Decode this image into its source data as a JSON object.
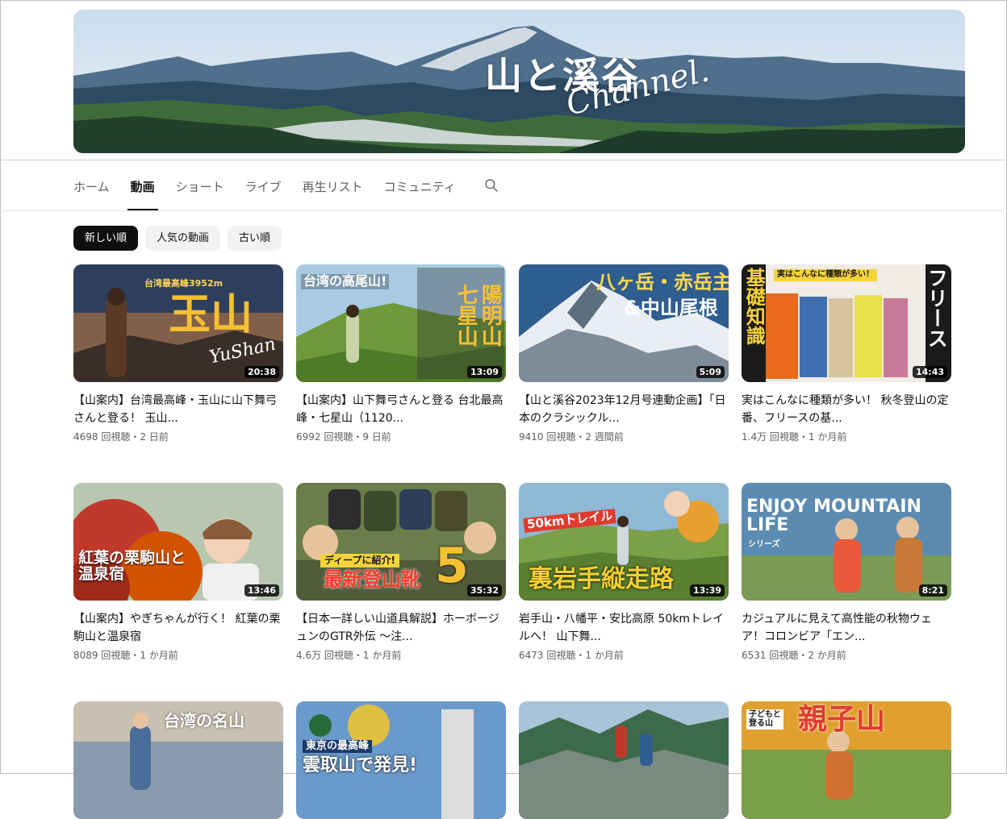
{
  "banner": {
    "title": "山と溪谷",
    "subtitle": "Channel."
  },
  "tabs": [
    {
      "label": "ホーム"
    },
    {
      "label": "動画",
      "active": true
    },
    {
      "label": "ショート"
    },
    {
      "label": "ライブ"
    },
    {
      "label": "再生リスト"
    },
    {
      "label": "コミュニティ"
    }
  ],
  "search": {
    "icon": "search-icon"
  },
  "chips": [
    {
      "label": "新しい順",
      "active": true
    },
    {
      "label": "人気の動画"
    },
    {
      "label": "古い順"
    }
  ],
  "videos": [
    {
      "title": "【山案内】台湾最高峰・玉山に山下舞弓さんと登る！ 玉山...",
      "meta": "4698 回視聴・2 日前",
      "duration": "20:38",
      "thumb": {
        "big": "玉山",
        "small": "台湾最高峰3952m",
        "script": "YuShan"
      },
      "colors": [
        "#2d3f5c",
        "#d98a3a"
      ]
    },
    {
      "title": "【山案内】山下舞弓さんと登る 台北最高峰・七星山（1120...",
      "meta": "6992 回視聴・9 日前",
      "duration": "13:09",
      "thumb": {
        "tag": "台湾の高尾山!",
        "big1": "七星山",
        "big2": "陽明山"
      },
      "colors": [
        "#8fb7d6",
        "#6e9a3c"
      ]
    },
    {
      "title": "【山と溪谷2023年12月号連動企画】「日本のクラシックル...",
      "meta": "9410 回視聴・2 週間前",
      "duration": "5:09",
      "thumb": {
        "line1": "八ヶ岳・赤岳主稜",
        "line2": "&中山尾根"
      },
      "colors": [
        "#2e5d8f",
        "#e8eef3"
      ]
    },
    {
      "title": "実はこんなに種類が多い！ 秋冬登山の定番、フリースの基...",
      "meta": "1.4万 回視聴・1 か月前",
      "duration": "14:43",
      "thumb": {
        "left": "基礎知識",
        "right": "フリース",
        "banner": "実はこんなに種類が多い！"
      },
      "colors": [
        "#1a1a1a",
        "#f5d33a"
      ]
    },
    {
      "title": "【山案内】やぎちゃんが行く！ 紅葉の栗駒山と温泉宿",
      "meta": "8089 回視聴・1 か月前",
      "duration": "13:46",
      "thumb": {
        "big": "紅葉の栗駒山と温泉宿"
      },
      "colors": [
        "#c0392b",
        "#8a5a3a"
      ]
    },
    {
      "title": "【日本一詳しい山道具解説】ホーボージュンのGTR外伝 ～注...",
      "meta": "4.6万 回視聴・1 か月前",
      "duration": "35:32",
      "thumb": {
        "tag": "ディープに紹介!",
        "big": "最新登山靴",
        "num": "5"
      },
      "colors": [
        "#556b2f",
        "#e0c040"
      ]
    },
    {
      "title": "岩手山・八幡平・安比高原 50kmトレイルへ！ 山下舞...",
      "meta": "6473 回視聴・1 か月前",
      "duration": "13:39",
      "thumb": {
        "tag": "50kmトレイル",
        "big": "裏岩手縦走路"
      },
      "colors": [
        "#6a9a3a",
        "#f0d040"
      ]
    },
    {
      "title": "カジュアルに見えて高性能の秋物ウェア！コロンビア「エン...",
      "meta": "6531 回視聴・2 か月前",
      "duration": "8:21",
      "thumb": {
        "big": "ENJOY MOUNTAIN LIFE",
        "sub": "シリーズ"
      },
      "colors": [
        "#5b8bb0",
        "#e8f1f6"
      ]
    },
    {
      "title": "",
      "meta": "",
      "duration": "",
      "thumb": {
        "big": "台湾の名山"
      },
      "colors": [
        "#8a9bb0",
        "#e0d8c8"
      ]
    },
    {
      "title": "",
      "meta": "",
      "duration": "",
      "thumb": {
        "big": "雲取山で発見!",
        "tag": "東京の最高峰"
      },
      "colors": [
        "#4a6e9a",
        "#f0d048"
      ]
    },
    {
      "title": "",
      "meta": "",
      "duration": "",
      "thumb": {
        "big": ""
      },
      "colors": [
        "#3d6a4a",
        "#a8c4d8"
      ]
    },
    {
      "title": "",
      "meta": "",
      "duration": "",
      "thumb": {
        "big": "親子山",
        "tag": "子どもと登る山"
      },
      "colors": [
        "#e0a030",
        "#7aa048"
      ]
    }
  ]
}
